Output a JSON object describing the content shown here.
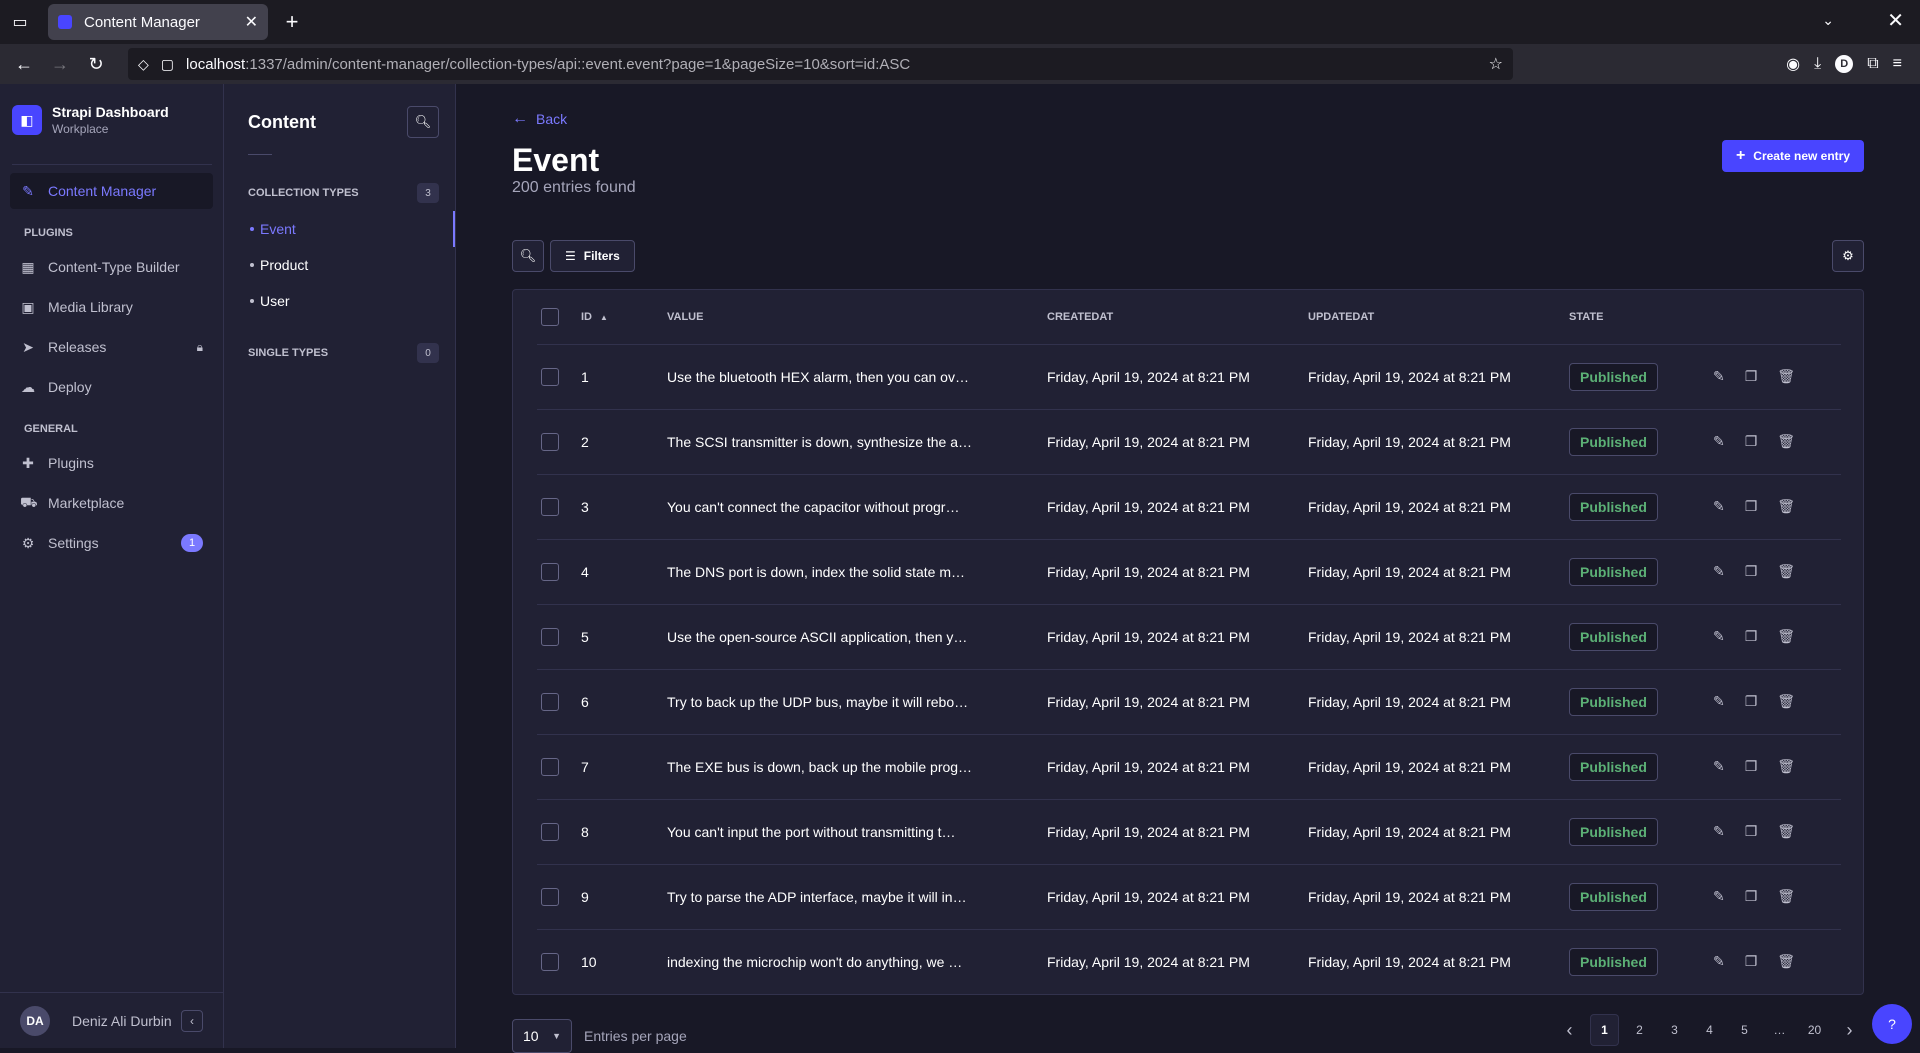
{
  "browser": {
    "tab_title": "Content Manager",
    "url_host": "localhost",
    "url_path": ":1337/admin/content-manager/collection-types/api::event.event?page=1&pageSize=10&sort=id:ASC",
    "profile_initial": "D"
  },
  "brand": {
    "title": "Strapi Dashboard",
    "subtitle": "Workplace"
  },
  "mainnav": {
    "content_manager": "Content Manager",
    "plugins_section": "PLUGINS",
    "content_type_builder": "Content-Type Builder",
    "media_library": "Media Library",
    "releases": "Releases",
    "deploy": "Deploy",
    "general_section": "GENERAL",
    "plugins": "Plugins",
    "marketplace": "Marketplace",
    "settings": "Settings",
    "settings_badge": "1",
    "user_initials": "DA",
    "user_name": "Deniz Ali Durbin"
  },
  "subnav": {
    "title": "Content",
    "collection_types_label": "COLLECTION TYPES",
    "collection_types_count": "3",
    "items": [
      {
        "label": "Event"
      },
      {
        "label": "Product"
      },
      {
        "label": "User"
      }
    ],
    "single_types_label": "SINGLE TYPES",
    "single_types_count": "0"
  },
  "main": {
    "back_label": "Back",
    "title": "Event",
    "entries_found": "200 entries found",
    "create_label": "Create new entry",
    "filters_label": "Filters"
  },
  "table": {
    "headers": {
      "id": "ID",
      "value": "VALUE",
      "createdat": "CREATEDAT",
      "updatedat": "UPDATEDAT",
      "state": "STATE"
    },
    "rows": [
      {
        "id": "1",
        "value": "Use the bluetooth HEX alarm, then you can ov…",
        "created": "Friday, April 19, 2024 at 8:21 PM",
        "updated": "Friday, April 19, 2024 at 8:21 PM",
        "state": "Published"
      },
      {
        "id": "2",
        "value": "The SCSI transmitter is down, synthesize the a…",
        "created": "Friday, April 19, 2024 at 8:21 PM",
        "updated": "Friday, April 19, 2024 at 8:21 PM",
        "state": "Published"
      },
      {
        "id": "3",
        "value": "You can't connect the capacitor without progr…",
        "created": "Friday, April 19, 2024 at 8:21 PM",
        "updated": "Friday, April 19, 2024 at 8:21 PM",
        "state": "Published"
      },
      {
        "id": "4",
        "value": "The DNS port is down, index the solid state m…",
        "created": "Friday, April 19, 2024 at 8:21 PM",
        "updated": "Friday, April 19, 2024 at 8:21 PM",
        "state": "Published"
      },
      {
        "id": "5",
        "value": "Use the open-source ASCII application, then y…",
        "created": "Friday, April 19, 2024 at 8:21 PM",
        "updated": "Friday, April 19, 2024 at 8:21 PM",
        "state": "Published"
      },
      {
        "id": "6",
        "value": "Try to back up the UDP bus, maybe it will rebo…",
        "created": "Friday, April 19, 2024 at 8:21 PM",
        "updated": "Friday, April 19, 2024 at 8:21 PM",
        "state": "Published"
      },
      {
        "id": "7",
        "value": "The EXE bus is down, back up the mobile prog…",
        "created": "Friday, April 19, 2024 at 8:21 PM",
        "updated": "Friday, April 19, 2024 at 8:21 PM",
        "state": "Published"
      },
      {
        "id": "8",
        "value": "You can't input the port without transmitting t…",
        "created": "Friday, April 19, 2024 at 8:21 PM",
        "updated": "Friday, April 19, 2024 at 8:21 PM",
        "state": "Published"
      },
      {
        "id": "9",
        "value": "Try to parse the ADP interface, maybe it will in…",
        "created": "Friday, April 19, 2024 at 8:21 PM",
        "updated": "Friday, April 19, 2024 at 8:21 PM",
        "state": "Published"
      },
      {
        "id": "10",
        "value": "indexing the microchip won't do anything, we …",
        "created": "Friday, April 19, 2024 at 8:21 PM",
        "updated": "Friday, April 19, 2024 at 8:21 PM",
        "state": "Published"
      }
    ]
  },
  "footer": {
    "page_size": "10",
    "per_page_label": "Entries per page",
    "pages": [
      "1",
      "2",
      "3",
      "4",
      "5",
      "…",
      "20"
    ],
    "current_page": "1"
  },
  "help_label": "?",
  "colors": {
    "accent": "#4945ff",
    "accent_text": "#7b79ff",
    "published": "#5cb176"
  }
}
